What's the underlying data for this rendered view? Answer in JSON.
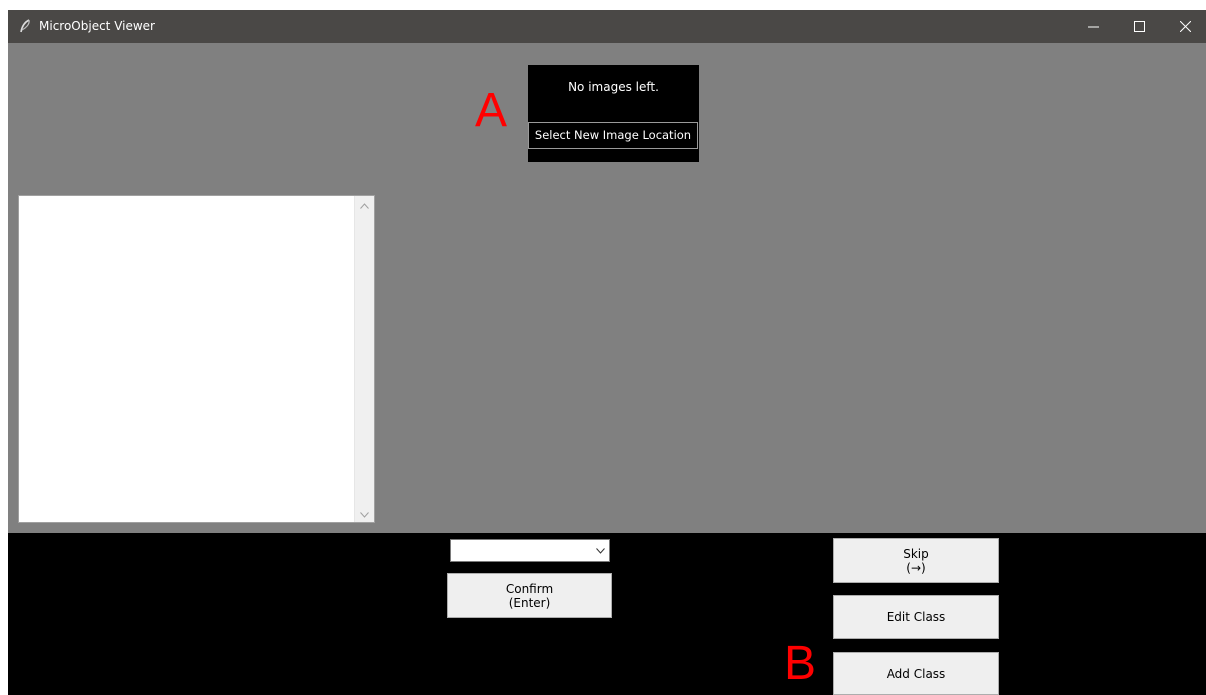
{
  "window": {
    "title": "MicroObject Viewer",
    "icon": "feather-icon",
    "controls": [
      "minimize-icon",
      "maximize-icon",
      "close-icon"
    ]
  },
  "top_panel": {
    "status_text": "No images left.",
    "select_location_label": "Select New Image Location"
  },
  "annotations": {
    "a": "A",
    "b": "B"
  },
  "class_list": {
    "items": []
  },
  "bottom_panel": {
    "combo_value": "",
    "confirm_label": "Confirm",
    "confirm_shortcut": "(Enter)",
    "skip_label": "Skip",
    "skip_shortcut": "(→)",
    "edit_class_label": "Edit Class",
    "add_class_label": "Add Class"
  },
  "colors": {
    "window_bg": "#808080",
    "titlebar_bg": "#4a4846",
    "panel_bg": "#000000",
    "button_bg": "#efefef",
    "annotation": "#ff0000"
  }
}
